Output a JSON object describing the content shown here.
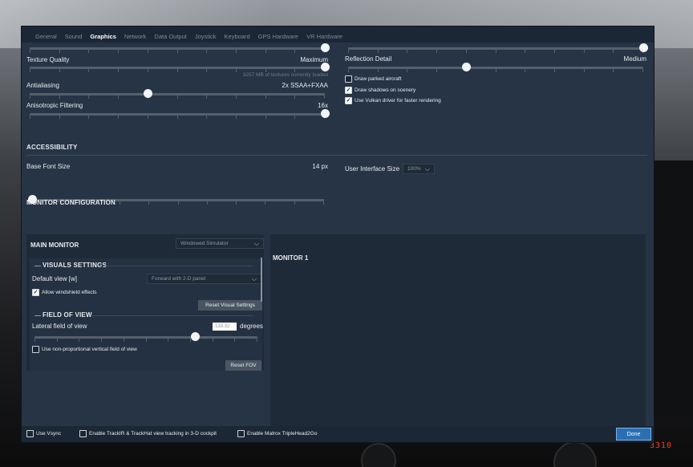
{
  "tabs": [
    "General",
    "Sound",
    "Graphics",
    "Network",
    "Data Output",
    "Joystick",
    "Keyboard",
    "GPS Hardware",
    "VR Hardware"
  ],
  "active_tab": "Graphics",
  "graphics": {
    "texture_quality": {
      "label": "Texture Quality",
      "value": "Maximum",
      "note": "3257 MB of textures currently loaded",
      "level": 1.0
    },
    "antialiasing": {
      "label": "Antialiasing",
      "value": "2x SSAA+FXAA",
      "level": 0.4
    },
    "anisotropic": {
      "label": "Anisotropic Filtering",
      "value": "16x",
      "level": 1.0
    },
    "reflection": {
      "label": "Reflection Detail",
      "value": "Medium",
      "level": 0.4
    },
    "top_left_level": 1.0,
    "top_right_level": 1.0,
    "checkboxes": [
      {
        "label": "Draw parked aircraft",
        "checked": false
      },
      {
        "label": "Draw shadows on scenery",
        "checked": true
      },
      {
        "label": "Use Vulkan driver for faster rendering",
        "checked": true
      }
    ]
  },
  "accessibility": {
    "title": "ACCESSIBILITY",
    "font_size_label": "Base Font Size",
    "font_size_value": "14 px",
    "font_size_level": 0.0,
    "ui_size_label": "User Interface Size",
    "ui_size_value": "100%"
  },
  "monitor": {
    "title": "MONITOR CONFIGURATION",
    "main_monitor_label": "MAIN MONITOR",
    "main_monitor_mode": "Windowed Simulator",
    "monitor1_label": "MONITOR 1",
    "visuals_title": "VISUALS SETTINGS",
    "default_view_label": "Default view [w]",
    "default_view_value": "Forward with 2-D panel",
    "windshield_label": "Allow windshield effects",
    "windshield_checked": true,
    "reset_visual_label": "Reset Visual Settings",
    "fov_title": "FIELD OF VIEW",
    "lateral_fov_label": "Lateral field of view",
    "lateral_fov_value": "133.32",
    "degrees_label": "degrees",
    "fov_level": 0.72,
    "nonprop_label": "Use non-proportional vertical field of view",
    "nonprop_checked": false,
    "reset_fov_label": "Reset FOV"
  },
  "footer": {
    "vsync": "Use Vsync",
    "trackir": "Enable TrackIR & TrackHat view tracking in 3-D cockpit",
    "matrox": "Enable Matrox TripleHead2Go",
    "done": "Done"
  },
  "background": {
    "led_readout": "3310"
  }
}
